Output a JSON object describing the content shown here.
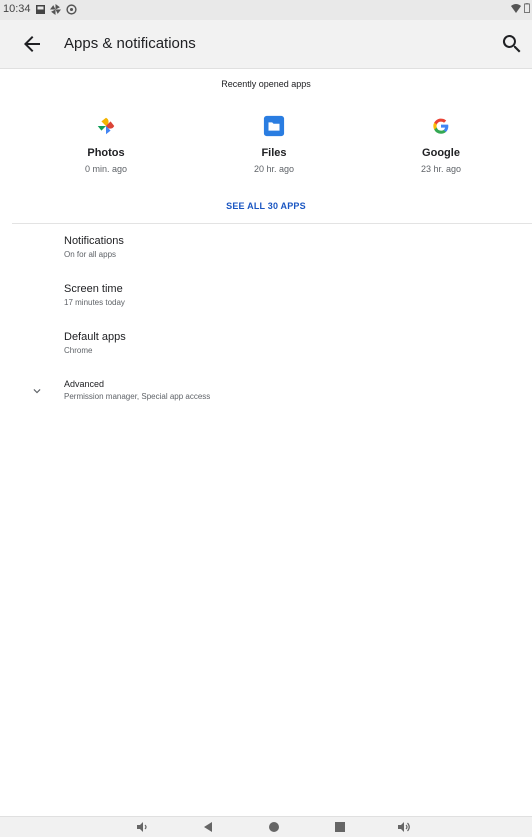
{
  "status": {
    "time": "10:34"
  },
  "toolbar": {
    "title": "Apps & notifications"
  },
  "recent": {
    "header": "Recently opened apps",
    "apps": [
      {
        "name": "Photos",
        "time": "0 min. ago",
        "icon": "photos-icon"
      },
      {
        "name": "Files",
        "time": "20 hr. ago",
        "icon": "files-icon"
      },
      {
        "name": "Google",
        "time": "23 hr. ago",
        "icon": "google-icon"
      }
    ],
    "see_all": "SEE ALL 30 APPS"
  },
  "prefs": [
    {
      "title": "Notifications",
      "summary": "On for all apps"
    },
    {
      "title": "Screen time",
      "summary": "17 minutes today"
    },
    {
      "title": "Default apps",
      "summary": "Chrome"
    },
    {
      "title": "Advanced",
      "summary": "Permission manager, Special app access"
    }
  ],
  "colors": {
    "accent": "#1a56c2",
    "toolbar_bg": "#f2f2f2"
  }
}
